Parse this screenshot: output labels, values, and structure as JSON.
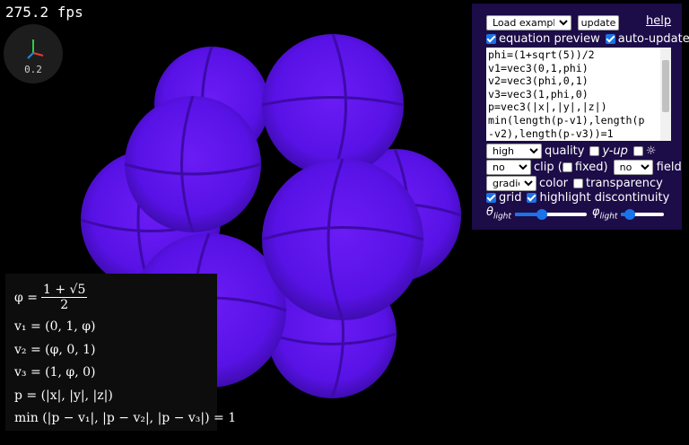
{
  "fps": "275.2 fps",
  "axes": {
    "zoom": "0.2"
  },
  "scene": {
    "sphere_color": "#5812e6",
    "background": "#000000"
  },
  "controls": {
    "load_example": "Load example...",
    "update": "update",
    "help": "help",
    "equation_preview": "equation preview",
    "auto_update": "auto-update",
    "equation_lines": [
      "phi=(1+sqrt(5))/2",
      "v1=vec3(0,1,phi)",
      "v2=vec3(phi,0,1)",
      "v3=vec3(1,phi,0)",
      "p=vec3(|x|,|y|,|z|)",
      "min(length(p-v1),length(p",
      "-v2),length(p-v3))=1"
    ],
    "quality_value": "high",
    "quality_label": "quality",
    "y_up_label": "y-up",
    "light_toggle": "☼",
    "clip_value": "no",
    "clip_label": "clip (",
    "fixed_label": "fixed)",
    "field_value": "no",
    "field_label": "field",
    "color_value": "gradient",
    "color_label": "color",
    "transparency_label": "transparency",
    "grid_label": "grid",
    "highlight_label": "highlight discontinuity",
    "theta_label": "θ",
    "phi_label": "φ",
    "light_sub": "light",
    "theta_value": 0.38,
    "phi_value": 0.2
  },
  "formula": {
    "phi_lhs": "φ =",
    "phi_num": "1 + √5",
    "phi_den": "2",
    "v1": "v₁ = (0, 1, φ)",
    "v2": "v₂ = (φ, 0, 1)",
    "v3": "v₃ = (1, φ, 0)",
    "p": "p = (|x|, |y|, |z|)",
    "min": "min (|p − v₁|, |p − v₂|, |p − v₃|) = 1"
  }
}
